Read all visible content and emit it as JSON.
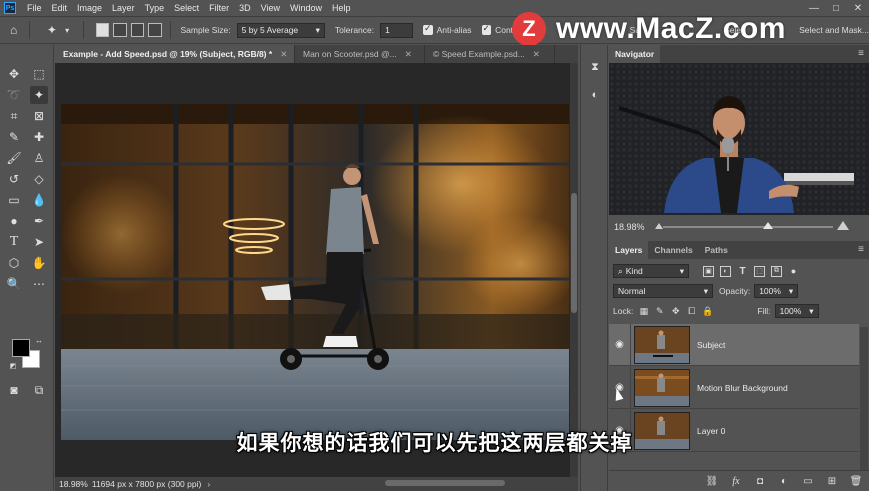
{
  "app": {
    "logo": "Ps"
  },
  "menu": [
    "File",
    "Edit",
    "Image",
    "Layer",
    "Type",
    "Select",
    "Filter",
    "3D",
    "View",
    "Window",
    "Help"
  ],
  "window_controls": [
    "—",
    "□",
    "✕"
  ],
  "options_bar": {
    "sample_size_label": "Sample Size:",
    "sample_size_value": "5 by 5 Average",
    "tolerance_label": "Tolerance:",
    "tolerance_value": "1",
    "anti_alias_label": "Anti-alias",
    "anti_alias_checked": true,
    "contiguous_label": "Contig",
    "contiguous_checked": true,
    "sample_all_label": "Sa",
    "select_subject_label": "Sele",
    "select_mask_label": "Select and Mask..."
  },
  "watermark": {
    "logo_letter": "Z",
    "text": "www.MacZ.com"
  },
  "tabs": [
    {
      "label": "Example - Add Speed.psd @ 19% (Subject, RGB/8) *",
      "close": "✕",
      "active": true
    },
    {
      "label": "Man on Scooter.psd @...",
      "close": "✕",
      "active": false
    },
    {
      "label": "© Speed Example.psd...",
      "close": "✕",
      "active": false
    }
  ],
  "status": {
    "zoom": "18.98%",
    "doc_info": "11694 px x 7800 px (300 ppi)",
    "arrow": "›"
  },
  "subtitle": "如果你想的话我们可以先把这两层都关掉",
  "navigator": {
    "title": "Navigator",
    "zoom": "18.98%",
    "zoom_level": 0.62
  },
  "layers_panel": {
    "tabs": [
      "Layers",
      "Channels",
      "Paths"
    ],
    "filter_kind": "Kind",
    "blend_mode": "Normal",
    "opacity_label": "Opacity:",
    "opacity_value": "100%",
    "lock_label": "Lock:",
    "fill_label": "Fill:",
    "fill_value": "100%",
    "layers": [
      {
        "name": "Subject",
        "visible": true,
        "selected": true
      },
      {
        "name": "Motion Blur Background",
        "visible": true,
        "selected": false
      },
      {
        "name": "Layer 0",
        "visible": true,
        "selected": false
      }
    ]
  },
  "colors": {
    "accent": "#31a8ff",
    "panel": "#535353",
    "dark": "#424242",
    "selected_layer": "#6c6c6c"
  }
}
